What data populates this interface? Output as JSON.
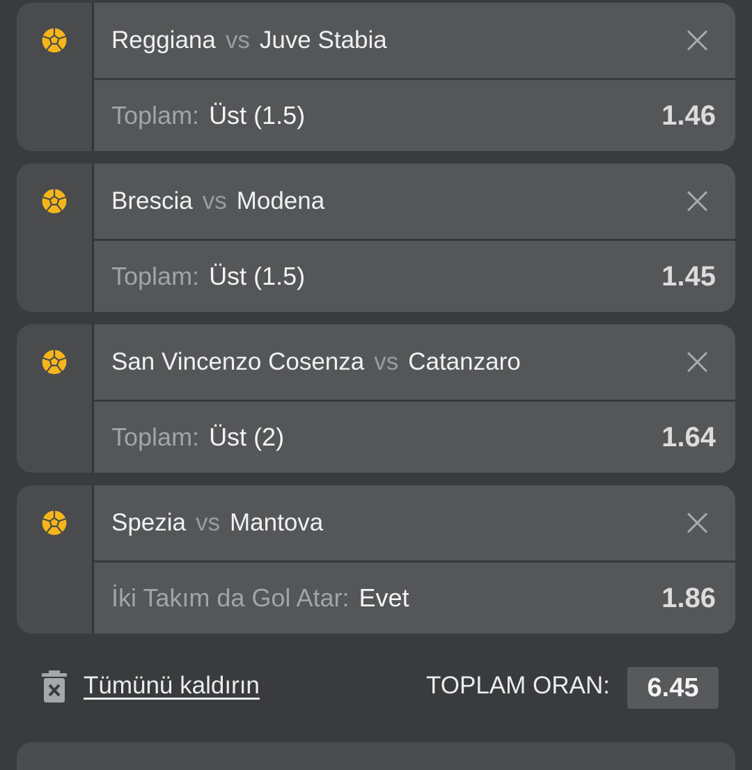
{
  "colors": {
    "background": "#3a3b3d",
    "card": "#4b4c4e",
    "row": "#555658",
    "ball": "#f5b51b",
    "muted_text": "#a3a4a6",
    "text": "#f1f1f1"
  },
  "bets": [
    {
      "sport_icon": "football-icon",
      "home": "Reggiana",
      "vs": "vs",
      "away": "Juve Stabia",
      "market": "Toplam:",
      "selection": "Üst (1.5)",
      "odd": "1.46"
    },
    {
      "sport_icon": "football-icon",
      "home": "Brescia",
      "vs": "vs",
      "away": "Modena",
      "market": "Toplam:",
      "selection": "Üst (1.5)",
      "odd": "1.45"
    },
    {
      "sport_icon": "football-icon",
      "home": "San Vincenzo Cosenza",
      "vs": "vs",
      "away": "Catanzaro",
      "market": "Toplam:",
      "selection": "Üst (2)",
      "odd": "1.64"
    },
    {
      "sport_icon": "football-icon",
      "home": "Spezia",
      "vs": "vs",
      "away": "Mantova",
      "market": "İki Takım da Gol Atar:",
      "selection": "Evet",
      "odd": "1.86"
    }
  ],
  "footer": {
    "remove_all_label": "Tümünü kaldırın",
    "total_label": "TOPLAM ORAN:",
    "total_value": "6.45"
  }
}
